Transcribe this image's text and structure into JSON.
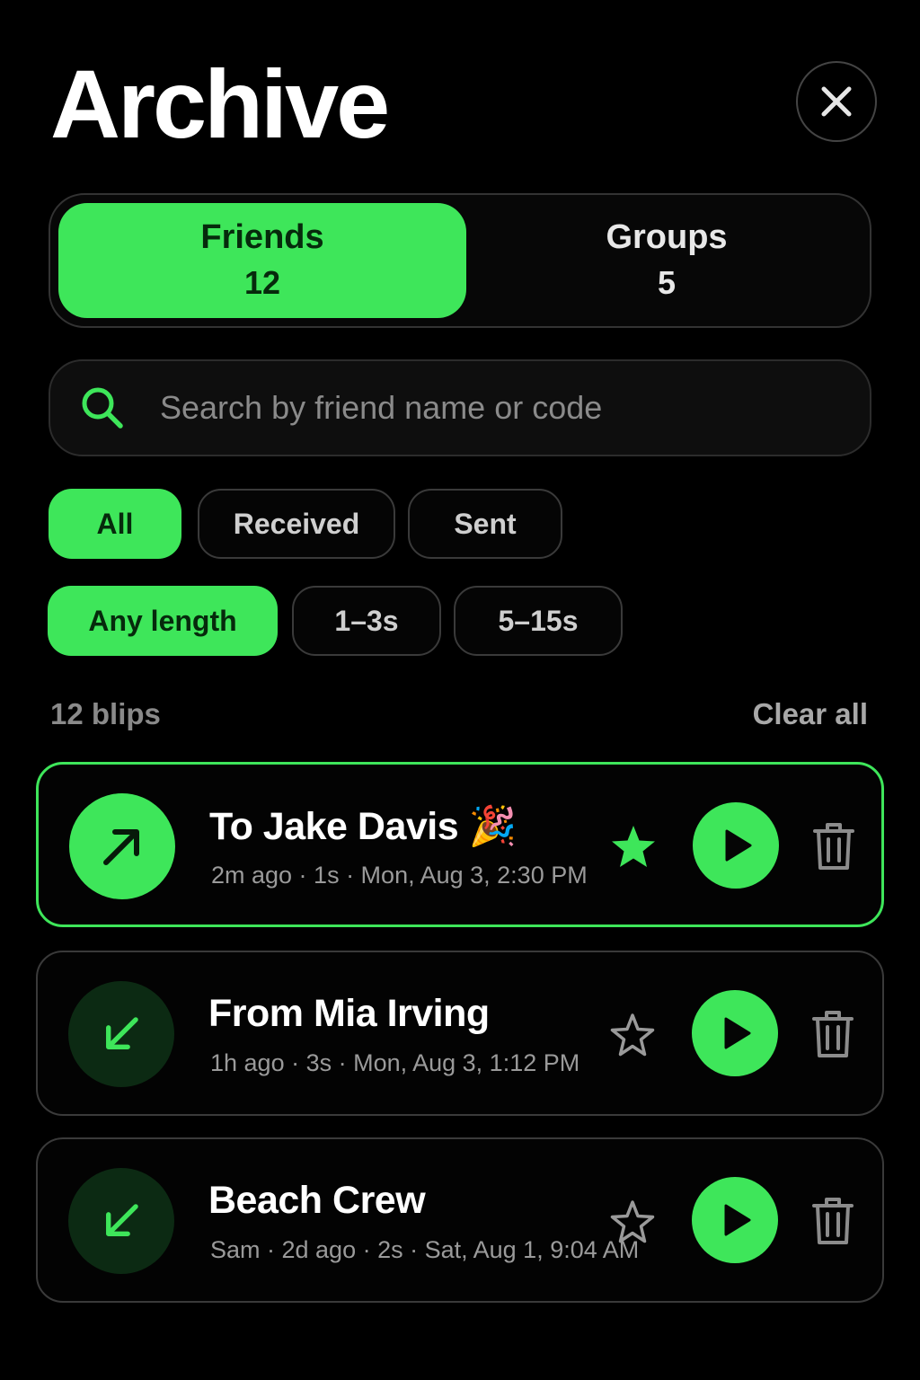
{
  "header": {
    "title": "Archive",
    "close_icon": "close-icon"
  },
  "tabs": [
    {
      "label": "Friends",
      "count": "12",
      "active": true
    },
    {
      "label": "Groups",
      "count": "5",
      "active": false
    }
  ],
  "search": {
    "placeholder": "Search by friend name or code",
    "value": "",
    "icon": "search-icon"
  },
  "filters": {
    "direction": [
      {
        "label": "All",
        "active": true
      },
      {
        "label": "Received",
        "active": false
      },
      {
        "label": "Sent",
        "active": false
      }
    ],
    "length": [
      {
        "label": "Any length",
        "active": true
      },
      {
        "label": "1–3s",
        "active": false
      },
      {
        "label": "5–15s",
        "active": false
      }
    ]
  },
  "list_header": {
    "count_label": "12 blips",
    "clear_label": "Clear all"
  },
  "blips": [
    {
      "title": "To Jake Davis 🎉",
      "meta": "2m ago · 1s · Mon, Aug 3, 2:30 PM",
      "direction": "sent",
      "direction_icon": "arrow-up-right-icon",
      "starred": true
    },
    {
      "title": "From Mia Irving",
      "meta": "1h ago · 3s · Mon, Aug 3, 1:12 PM",
      "direction": "received",
      "direction_icon": "arrow-down-left-icon",
      "starred": false
    },
    {
      "title": "Beach Crew",
      "meta": "Sam · 2d ago · 2s · Sat, Aug 1, 9:04 AM",
      "direction": "received",
      "direction_icon": "arrow-down-left-icon",
      "starred": false
    }
  ],
  "colors": {
    "accent": "#3ee65a",
    "background": "#000000",
    "muted_text": "#8a8a8a"
  }
}
